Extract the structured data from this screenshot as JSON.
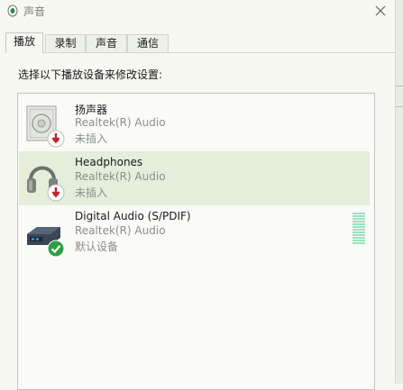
{
  "window": {
    "title": "声音"
  },
  "tabs": [
    {
      "label": "播放",
      "active": true
    },
    {
      "label": "录制"
    },
    {
      "label": "声音"
    },
    {
      "label": "通信"
    }
  ],
  "instruction": "选择以下播放设备来修改设置:",
  "devices": [
    {
      "name": "扬声器",
      "driver": "Realtek(R) Audio",
      "status": "未插入",
      "icon": "speaker-icon",
      "badge": "unplugged-badge-icon"
    },
    {
      "name": "Headphones",
      "driver": "Realtek(R) Audio",
      "status": "未插入",
      "icon": "headphones-icon",
      "badge": "unplugged-badge-icon",
      "selected": true
    },
    {
      "name": "Digital Audio (S/PDIF)",
      "driver": "Realtek(R) Audio",
      "status": "默认设备",
      "icon": "digital-audio-icon",
      "badge": "default-check-icon"
    }
  ],
  "colors": {
    "selection": "#e4eedb",
    "unplugged": "#c0242b",
    "default": "#2ea043",
    "meter": "#9fe0bd"
  }
}
